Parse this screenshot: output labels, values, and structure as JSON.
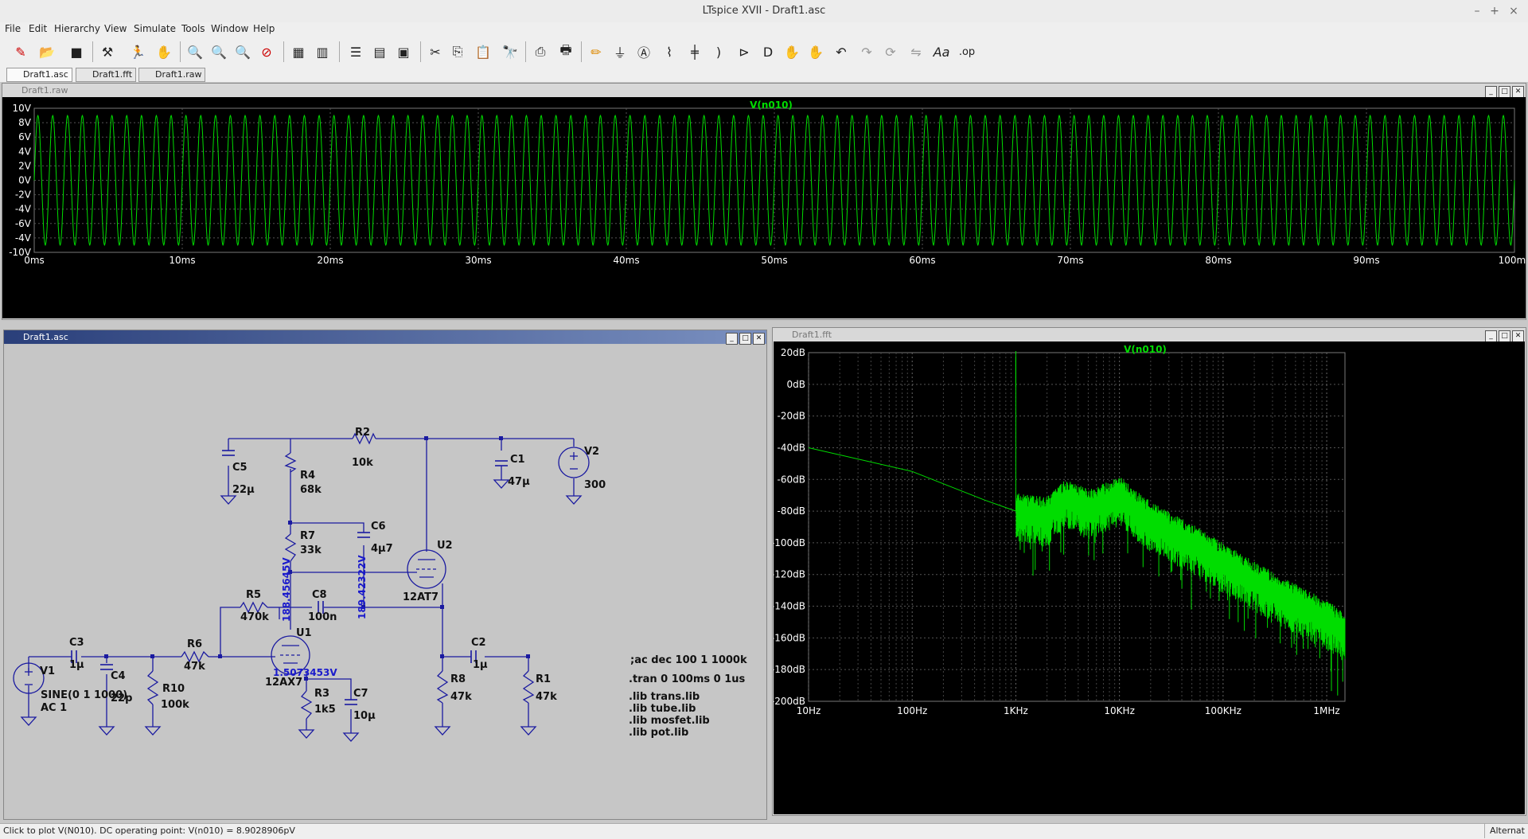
{
  "window": {
    "title": "LTspice XVII - Draft1.asc"
  },
  "menu": [
    "File",
    "Edit",
    "Hierarchy",
    "View",
    "Simulate",
    "Tools",
    "Window",
    "Help"
  ],
  "tabs": [
    "Draft1.asc",
    "Draft1.fft",
    "Draft1.raw"
  ],
  "waveform": {
    "window_title": "Draft1.raw",
    "trace_label": "V(n010)",
    "y_ticks": [
      "10V",
      "8V",
      "6V",
      "4V",
      "2V",
      "0V",
      "-2V",
      "-4V",
      "-6V",
      "-4V",
      "-10V"
    ],
    "x_ticks": [
      "0ms",
      "10ms",
      "20ms",
      "30ms",
      "40ms",
      "50ms",
      "60ms",
      "70ms",
      "80ms",
      "90ms",
      "100ms"
    ]
  },
  "schematic": {
    "window_title": "Draft1.asc",
    "components": {
      "R2": {
        "name": "R2",
        "value": "10k"
      },
      "C5": {
        "name": "C5",
        "value": "22µ"
      },
      "R4": {
        "name": "R4",
        "value": "68k"
      },
      "C1": {
        "name": "C1",
        "value": "47µ"
      },
      "V2": {
        "name": "V2",
        "value": "300"
      },
      "C6": {
        "name": "C6",
        "value": "4µ7"
      },
      "R7": {
        "name": "R7",
        "value": "33k"
      },
      "U2": {
        "name": "U2",
        "value": "12AT7"
      },
      "R5": {
        "name": "R5",
        "value": "470k"
      },
      "C8": {
        "name": "C8",
        "value": "100n"
      },
      "U1": {
        "name": "U1",
        "value": "12AX7"
      },
      "C3": {
        "name": "C3",
        "value": "1µ"
      },
      "C4": {
        "name": "C4",
        "value": "22p"
      },
      "R6": {
        "name": "R6",
        "value": "47k"
      },
      "R10": {
        "name": "R10",
        "value": "100k"
      },
      "V1": {
        "name": "V1",
        "value": "SINE(0 1 1000)",
        "value2": "AC 1"
      },
      "R3": {
        "name": "R3",
        "value": "1k5"
      },
      "C7": {
        "name": "C7",
        "value": "10µ"
      },
      "C2": {
        "name": "C2",
        "value": "1µ"
      },
      "R8": {
        "name": "R8",
        "value": "47k"
      },
      "R1": {
        "name": "R1",
        "value": "47k"
      }
    },
    "op_labels": {
      "v1": "188.45645V",
      "v2": "189.42322V",
      "v3": "1.5073453V"
    },
    "directives": [
      ";ac dec 100 1 1000k",
      ".tran 0 100ms 0 1us",
      ".lib trans.lib",
      ".lib tube.lib",
      ".lib mosfet.lib",
      ".lib pot.lib"
    ]
  },
  "fft": {
    "window_title": "Draft1.fft",
    "trace_label": "V(n010)",
    "y_ticks": [
      "20dB",
      "0dB",
      "-20dB",
      "-40dB",
      "-60dB",
      "-80dB",
      "-100dB",
      "-120dB",
      "-140dB",
      "-160dB",
      "-180dB",
      "-200dB"
    ],
    "x_ticks": [
      "10Hz",
      "100Hz",
      "1KHz",
      "10KHz",
      "100KHz",
      "1MHz"
    ]
  },
  "status": {
    "message": "Click to plot V(N010).  DC operating point: V(n010) = 8.9028906pV",
    "right": "Alternat"
  },
  "colors": {
    "trace": "#00dd00",
    "plot_bg": "#000000",
    "wire": "#1a1aa0",
    "op_text": "#1a1acc"
  },
  "chart_data": [
    {
      "type": "line",
      "title": "V(n010)",
      "xlabel": "",
      "ylabel": "",
      "xlim": [
        0,
        100
      ],
      "ylim": [
        -10,
        10
      ],
      "x_unit": "ms",
      "y_unit": "V",
      "grid": true,
      "series": [
        {
          "name": "V(n010)",
          "amplitude": 9,
          "frequency_hz": 1000
        }
      ]
    },
    {
      "type": "line",
      "title": "V(n010)",
      "xlabel": "",
      "ylabel": "",
      "x_scale": "log",
      "xlim": [
        10,
        1500000
      ],
      "ylim": [
        -200,
        20
      ],
      "x_unit": "Hz",
      "y_unit": "dB",
      "grid": true,
      "series": [
        {
          "name": "V(n010)",
          "x": [
            10,
            100,
            500,
            1000,
            1000,
            1000,
            2000,
            3000,
            5000,
            10000,
            20000,
            50000,
            100000,
            300000,
            1000000,
            1500000
          ],
          "y": [
            -40,
            -55,
            -73,
            -80,
            17,
            -80,
            -83,
            -72,
            -78,
            -70,
            -86,
            -100,
            -112,
            -130,
            -148,
            -156
          ]
        }
      ]
    }
  ]
}
